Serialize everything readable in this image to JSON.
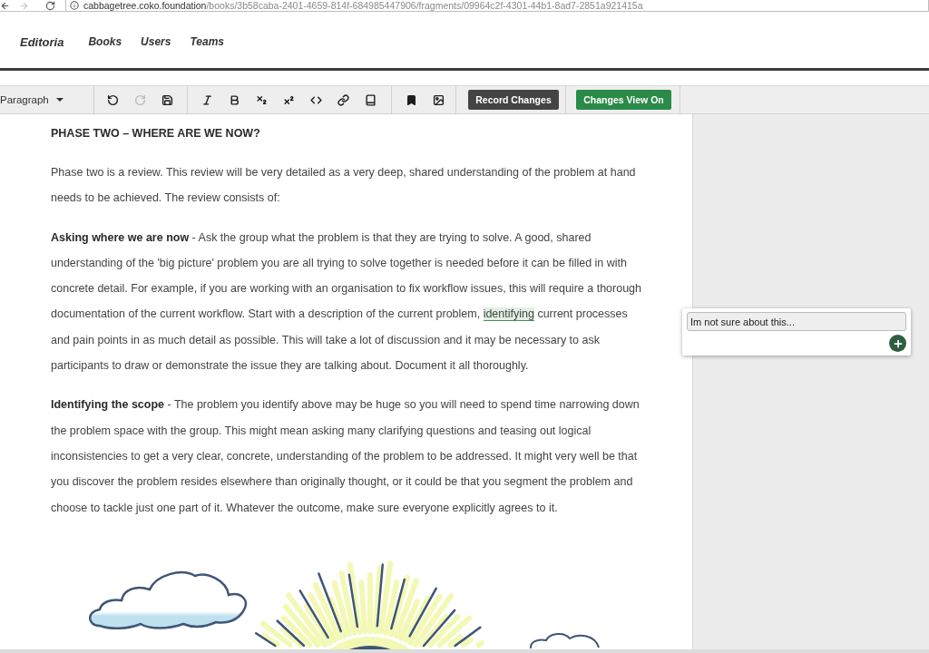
{
  "browser": {
    "nav_buttons": [
      {
        "kind": "back",
        "disabled": false
      },
      {
        "kind": "forward",
        "disabled": true
      },
      {
        "kind": "reload",
        "disabled": false
      }
    ],
    "address": {
      "host": "cabbagetree.coko.foundation",
      "path": "/books/3b58caba-2401-4659-814f-684985447906/fragments/09964c2f-4301-44b1-8ad7-2851a921415a"
    }
  },
  "header": {
    "brand": "Editoria",
    "nav": [
      {
        "label": "Books"
      },
      {
        "label": "Users"
      },
      {
        "label": "Teams"
      }
    ]
  },
  "toolbar": {
    "block_style": "Paragraph",
    "groups": [
      {
        "tools": [
          {
            "kind": "undo",
            "disabled": false
          },
          {
            "kind": "redo",
            "disabled": true
          },
          {
            "kind": "save",
            "disabled": false
          }
        ]
      },
      {
        "tools": [
          {
            "kind": "italic",
            "disabled": false
          },
          {
            "kind": "bold",
            "disabled": false
          },
          {
            "kind": "subscript",
            "disabled": false
          },
          {
            "kind": "superscript",
            "disabled": false
          },
          {
            "kind": "code",
            "disabled": false
          },
          {
            "kind": "link",
            "disabled": false
          },
          {
            "kind": "book",
            "disabled": false
          }
        ]
      },
      {
        "tools": [
          {
            "kind": "bookmark",
            "disabled": false
          },
          {
            "kind": "image",
            "disabled": false
          }
        ]
      }
    ],
    "actions": [
      {
        "label": "Record Changes",
        "kind": "record"
      },
      {
        "label": "Changes View On",
        "kind": "view"
      }
    ]
  },
  "document": {
    "heading": "PHASE TWO – WHERE ARE WE NOW?",
    "paragraphs": [
      {
        "segments": [
          {
            "kind": "plain",
            "text": "Phase two is a review. This review will be very detailed as a very deep, shared understanding of the problem at hand needs to be achieved. The review consists of:"
          }
        ]
      },
      {
        "segments": [
          {
            "kind": "bold",
            "text": "Asking where we are now"
          },
          {
            "kind": "plain",
            "text": " - Ask the group what the problem is that they are trying to solve. A good, shared understanding of the 'big picture' problem you are all trying to solve together is needed before it can be filled in with concrete detail. For example, if you are working with an organisation to fix workflow issues, this will require a thorough documentation of the current workflow. Start with a description of the current problem, "
          },
          {
            "kind": "comment",
            "text": "identifying"
          },
          {
            "kind": "plain",
            "text": " current processes and pain points in as much detail as possible. This will take a lot of discussion and it may be necessary to ask participants to draw or demonstrate the issue they are talking about. Document it all thoroughly."
          }
        ]
      },
      {
        "segments": [
          {
            "kind": "bold",
            "text": "Identifying the scope"
          },
          {
            "kind": "plain",
            "text": " - The problem you identify above may be huge so you will need to spend time narrowing down the problem space with the group. This might mean asking many clarifying questions and teasing out logical inconsistencies to get a very clear, concrete, understanding of the problem to be addressed. It might very well be that you discover the problem resides elsewhere than originally thought, or it could be that you segment the problem and choose to tackle just one part of it. Whatever the outcome, make sure everyone explicitly agrees to it."
          }
        ]
      }
    ]
  },
  "comment": {
    "value": "Im not sure about this..."
  }
}
